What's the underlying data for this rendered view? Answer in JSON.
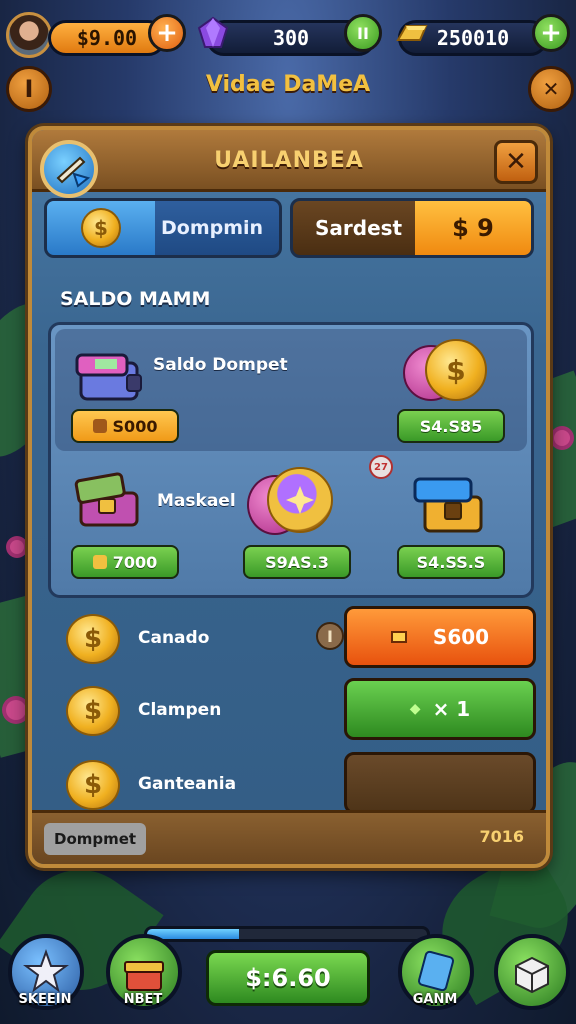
{
  "top_bar": {
    "coins": "$9.00",
    "gems": "300",
    "gold": "250010",
    "coins_add": "+",
    "gems_add": "II",
    "gold_add": "+"
  },
  "scene": {
    "title": "Vidae DaMeA",
    "left_button": "I",
    "right_button": "✕"
  },
  "panel": {
    "title": "UAILANBEA",
    "close": "✕",
    "tab_left_label": "Dompmin",
    "tab_left_coin": "$",
    "tab_right_label": "Sardest",
    "tab_right_price": "$ 9",
    "section_label": "SALDO MAMM",
    "items": [
      {
        "name": "Saldo Dompet",
        "price": "S000",
        "pill_color": "orange"
      },
      {
        "name": "",
        "price": "S4.S85",
        "pill_color": "green"
      },
      {
        "name": "Maskael",
        "price": "7000",
        "pill_color": "green"
      },
      {
        "name": "",
        "price": "S9AS.3",
        "pill_color": "green"
      },
      {
        "name": "",
        "price": "S4.SS.S",
        "pill_color": "green"
      }
    ],
    "badge_small": "27",
    "rows": [
      {
        "label": "Canado",
        "button": "S600",
        "info": "I"
      },
      {
        "label": "Clampen",
        "button": "× 1"
      },
      {
        "label": "Ganteania",
        "button": ""
      }
    ],
    "footer_left": "Dompmet",
    "footer_right": "7016"
  },
  "bottom_nav": {
    "left_label": "SKEEIN",
    "left_mid_label": "NBET",
    "balance": "$:6.60",
    "right_mid_label": "GANM",
    "progress": 0.33
  },
  "colors": {
    "accent_orange": "#f08a10",
    "accent_green": "#3a9a28",
    "panel_blue": "#3a6690",
    "frame_gold": "#c08a3a"
  }
}
